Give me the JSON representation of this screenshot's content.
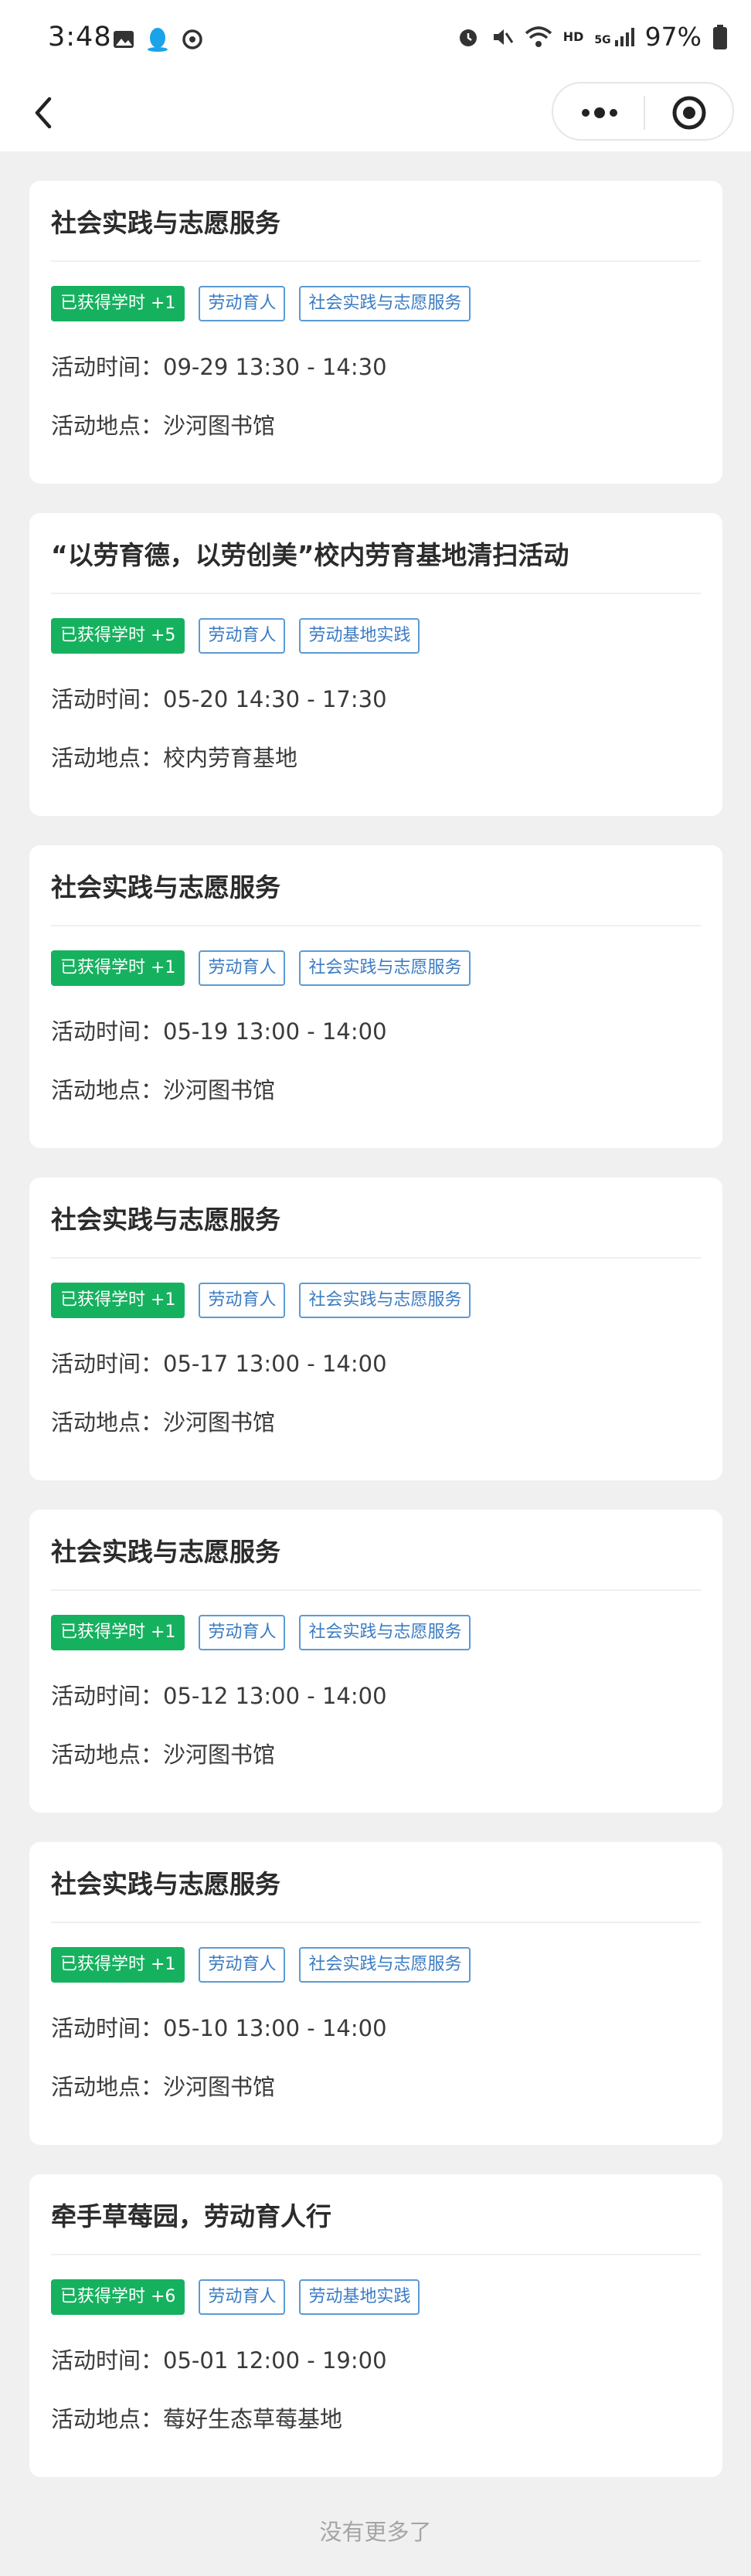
{
  "status_bar": {
    "time": "3:48",
    "network": "HD",
    "signal": "5G",
    "battery": "97%"
  },
  "nav": {
    "back_icon": "chevron-left-icon",
    "more_icon": "more-dots-icon",
    "target_icon": "target-icon"
  },
  "cards": [
    {
      "title": "社会实践与志愿服务",
      "credit": "已获得学时 +1",
      "tags": [
        "劳动育人",
        "社会实践与志愿服务"
      ],
      "time": "活动时间：09-29 13:30 - 14:30",
      "place": "活动地点：沙河图书馆"
    },
    {
      "title": "“以劳育德，以劳创美”校内劳育基地清扫活动",
      "credit": "已获得学时 +5",
      "tags": [
        "劳动育人",
        "劳动基地实践"
      ],
      "time": "活动时间：05-20 14:30 - 17:30",
      "place": "活动地点：校内劳育基地"
    },
    {
      "title": "社会实践与志愿服务",
      "credit": "已获得学时 +1",
      "tags": [
        "劳动育人",
        "社会实践与志愿服务"
      ],
      "time": "活动时间：05-19 13:00 - 14:00",
      "place": "活动地点：沙河图书馆"
    },
    {
      "title": "社会实践与志愿服务",
      "credit": "已获得学时 +1",
      "tags": [
        "劳动育人",
        "社会实践与志愿服务"
      ],
      "time": "活动时间：05-17 13:00 - 14:00",
      "place": "活动地点：沙河图书馆"
    },
    {
      "title": "社会实践与志愿服务",
      "credit": "已获得学时 +1",
      "tags": [
        "劳动育人",
        "社会实践与志愿服务"
      ],
      "time": "活动时间：05-12 13:00 - 14:00",
      "place": "活动地点：沙河图书馆"
    },
    {
      "title": "社会实践与志愿服务",
      "credit": "已获得学时 +1",
      "tags": [
        "劳动育人",
        "社会实践与志愿服务"
      ],
      "time": "活动时间：05-10 13:00 - 14:00",
      "place": "活动地点：沙河图书馆"
    },
    {
      "title": "牵手草莓园，劳动育人行",
      "credit": "已获得学时 +6",
      "tags": [
        "劳动育人",
        "劳动基地实践"
      ],
      "time": "活动时间：05-01 12:00 - 19:00",
      "place": "活动地点：莓好生态草莓基地"
    }
  ],
  "footer": "没有更多了",
  "colors": {
    "credit_tag": "#16b15f",
    "category_tag": "#5b9bd5",
    "background": "#f0f0f0"
  }
}
